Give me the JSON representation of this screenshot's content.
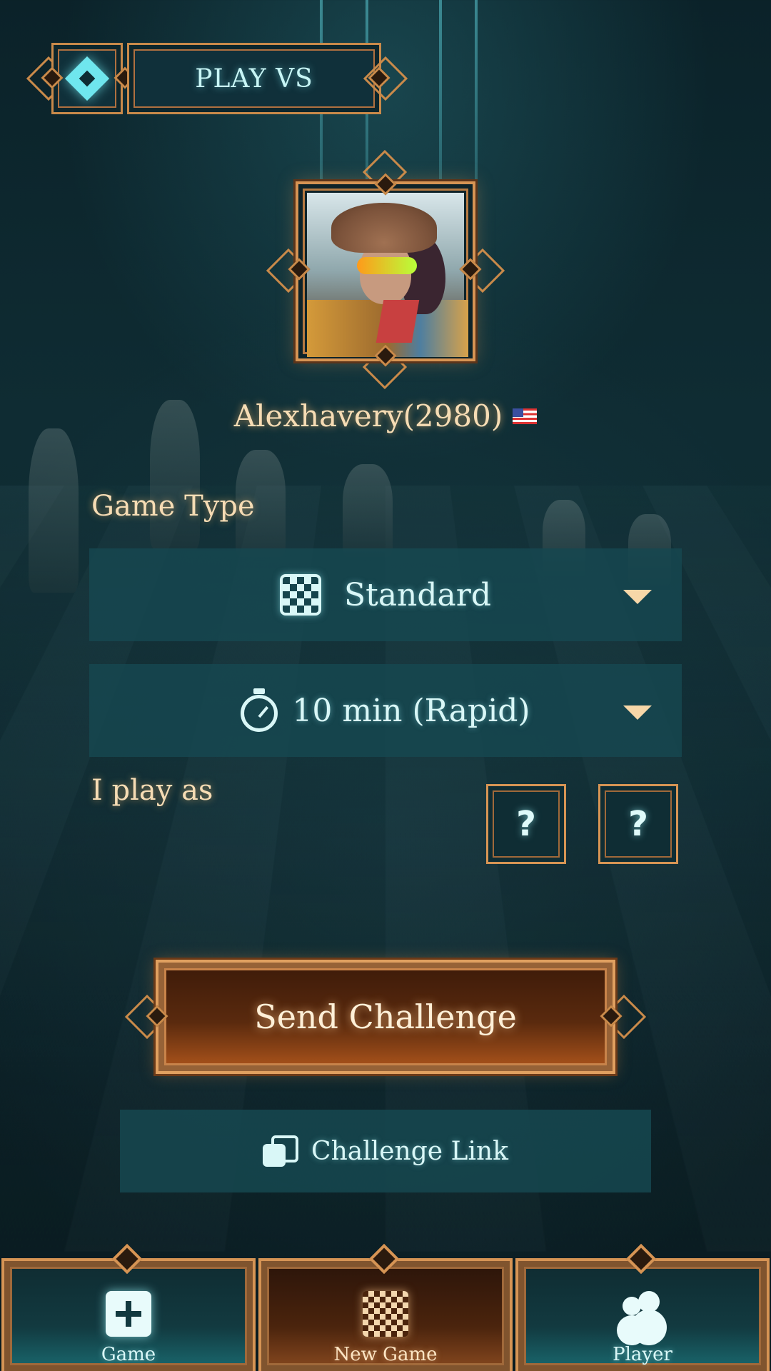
{
  "header": {
    "title": "PLAY VS",
    "back_icon": "diamond-back-icon"
  },
  "player": {
    "name": "Alexhavery(2980)",
    "flag": "us-flag-icon"
  },
  "game_type": {
    "label": "Game Type",
    "variant": {
      "icon": "checkerboard-icon",
      "value": "Standard"
    },
    "time": {
      "icon": "stopwatch-icon",
      "value": "10 min (Rapid)"
    }
  },
  "play_as": {
    "label": "I play as",
    "options": [
      "?",
      "?"
    ]
  },
  "actions": {
    "send_challenge": "Send Challenge",
    "challenge_link": "Challenge Link"
  },
  "bottom_nav": {
    "items": [
      {
        "label": "Game",
        "icon": "plus-square-icon",
        "active": false
      },
      {
        "label": "New Game",
        "icon": "checkerboard-icon",
        "active": true
      },
      {
        "label": "Player",
        "icon": "users-icon",
        "active": false
      }
    ]
  },
  "colors": {
    "accent_gold": "#d69454",
    "accent_cyan": "#d9f7f7",
    "panel_teal": "#16484f",
    "button_copper": "#b0561c"
  }
}
